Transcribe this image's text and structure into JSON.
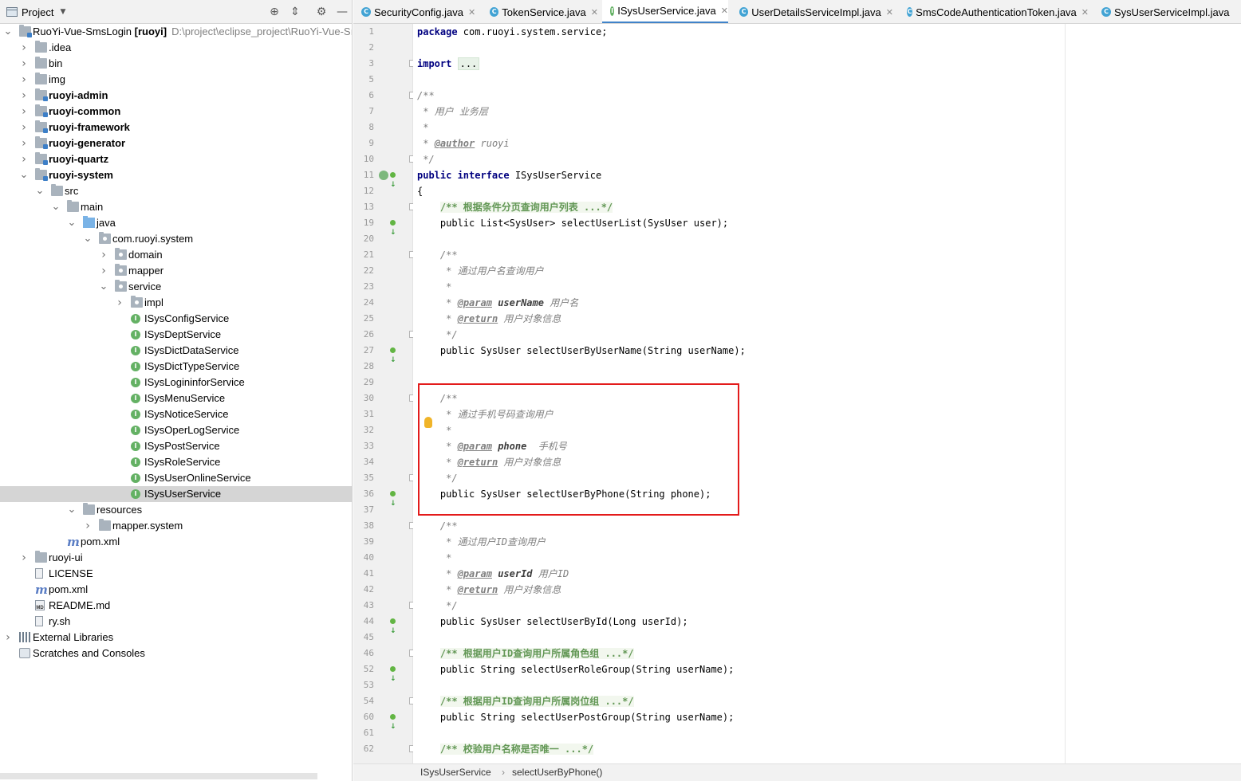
{
  "project": {
    "title": "Project",
    "tree": [
      {
        "label": "RuoYi-Vue-SmsLogin",
        "suffix": "[ruoyi]",
        "path": "D:\\project\\eclipse_project\\RuoYi-Vue-Sı",
        "icon": "module-folder-icon",
        "expanded": true,
        "bold": false
      },
      {
        "label": ".idea",
        "icon": "folder-icon",
        "expanded": false
      },
      {
        "label": "bin",
        "icon": "folder-icon",
        "expanded": false
      },
      {
        "label": "img",
        "icon": "folder-icon",
        "expanded": false
      },
      {
        "label": "ruoyi-admin",
        "icon": "module-folder-icon",
        "expanded": false,
        "bold": true
      },
      {
        "label": "ruoyi-common",
        "icon": "module-folder-icon",
        "expanded": false,
        "bold": true
      },
      {
        "label": "ruoyi-framework",
        "icon": "module-folder-icon",
        "expanded": false,
        "bold": true
      },
      {
        "label": "ruoyi-generator",
        "icon": "module-folder-icon",
        "expanded": false,
        "bold": true
      },
      {
        "label": "ruoyi-quartz",
        "icon": "module-folder-icon",
        "expanded": false,
        "bold": true
      },
      {
        "label": "ruoyi-system",
        "icon": "module-folder-icon",
        "expanded": true,
        "bold": true
      },
      {
        "label": "src",
        "icon": "folder-icon",
        "expanded": true
      },
      {
        "label": "main",
        "icon": "folder-icon",
        "expanded": true
      },
      {
        "label": "java",
        "icon": "source-folder-icon",
        "expanded": true
      },
      {
        "label": "com.ruoyi.system",
        "icon": "package-icon",
        "expanded": true
      },
      {
        "label": "domain",
        "icon": "package-icon",
        "expanded": false
      },
      {
        "label": "mapper",
        "icon": "package-icon",
        "expanded": false
      },
      {
        "label": "service",
        "icon": "package-icon",
        "expanded": true
      },
      {
        "label": "impl",
        "icon": "package-icon",
        "expanded": false
      },
      {
        "label": "ISysConfigService",
        "icon": "interface-icon"
      },
      {
        "label": "ISysDeptService",
        "icon": "interface-icon"
      },
      {
        "label": "ISysDictDataService",
        "icon": "interface-icon"
      },
      {
        "label": "ISysDictTypeService",
        "icon": "interface-icon"
      },
      {
        "label": "ISysLogininforService",
        "icon": "interface-icon"
      },
      {
        "label": "ISysMenuService",
        "icon": "interface-icon"
      },
      {
        "label": "ISysNoticeService",
        "icon": "interface-icon"
      },
      {
        "label": "ISysOperLogService",
        "icon": "interface-icon"
      },
      {
        "label": "ISysPostService",
        "icon": "interface-icon"
      },
      {
        "label": "ISysRoleService",
        "icon": "interface-icon"
      },
      {
        "label": "ISysUserOnlineService",
        "icon": "interface-icon"
      },
      {
        "label": "ISysUserService",
        "icon": "interface-icon",
        "selected": true
      },
      {
        "label": "resources",
        "icon": "resources-folder-icon",
        "expanded": true
      },
      {
        "label": "mapper.system",
        "icon": "folder-icon",
        "expanded": false
      },
      {
        "label": "pom.xml",
        "icon": "maven-icon"
      },
      {
        "label": "ruoyi-ui",
        "icon": "folder-icon",
        "expanded": false
      },
      {
        "label": "LICENSE",
        "icon": "text-file-icon"
      },
      {
        "label": "pom.xml",
        "icon": "maven-icon"
      },
      {
        "label": "README.md",
        "icon": "markdown-file-icon"
      },
      {
        "label": "ry.sh",
        "icon": "shell-file-icon"
      },
      {
        "label": "External Libraries",
        "icon": "libraries-icon",
        "expanded": false
      },
      {
        "label": "Scratches and Consoles",
        "icon": "scratches-icon"
      }
    ]
  },
  "tabs": [
    {
      "label": "SecurityConfig.java",
      "kind": "class",
      "closable": true
    },
    {
      "label": "TokenService.java",
      "kind": "class",
      "closable": true
    },
    {
      "label": "ISysUserService.java",
      "kind": "interface",
      "closable": true,
      "active": true
    },
    {
      "label": "UserDetailsServiceImpl.java",
      "kind": "class",
      "closable": true
    },
    {
      "label": "SmsCodeAuthenticationToken.java",
      "kind": "class",
      "closable": true
    },
    {
      "label": "SysUserServiceImpl.java",
      "kind": "class",
      "closable": false
    }
  ],
  "code": {
    "lines": [
      {
        "num": "1",
        "parts": [
          [
            "kw",
            "package"
          ],
          [
            "t",
            " com.ruoyi.system.service;"
          ]
        ]
      },
      {
        "num": "2",
        "parts": []
      },
      {
        "num": "3",
        "parts": [
          [
            "kw",
            "import"
          ],
          [
            "t",
            " "
          ],
          [
            "folded",
            "..."
          ]
        ]
      },
      {
        "num": "5",
        "parts": []
      },
      {
        "num": "6",
        "parts": [
          [
            "cm",
            "/**"
          ]
        ]
      },
      {
        "num": "7",
        "parts": [
          [
            "cm",
            " * 用户 业务层"
          ]
        ]
      },
      {
        "num": "8",
        "parts": [
          [
            "cm",
            " *"
          ]
        ]
      },
      {
        "num": "9",
        "parts": [
          [
            "cm",
            " * "
          ],
          [
            "tag",
            "@author"
          ],
          [
            "cm",
            " ruoyi"
          ]
        ]
      },
      {
        "num": "10",
        "parts": [
          [
            "cm",
            " */"
          ]
        ]
      },
      {
        "num": "11",
        "parts": [
          [
            "kw",
            "public interface"
          ],
          [
            "t",
            " ISysUserService"
          ]
        ]
      },
      {
        "num": "12",
        "parts": [
          [
            "t",
            "{"
          ]
        ]
      },
      {
        "num": "13",
        "parts": [
          [
            "t",
            "    "
          ],
          [
            "docf",
            "/** 根据条件分页查询用户列表 ...*/"
          ]
        ]
      },
      {
        "num": "19",
        "parts": [
          [
            "t",
            "    public List<SysUser> selectUserList(SysUser user);"
          ]
        ]
      },
      {
        "num": "20",
        "parts": []
      },
      {
        "num": "21",
        "parts": [
          [
            "t",
            "    "
          ],
          [
            "cm",
            "/**"
          ]
        ]
      },
      {
        "num": "22",
        "parts": [
          [
            "t",
            "    "
          ],
          [
            "cm",
            " * 通过用户名查询用户"
          ]
        ]
      },
      {
        "num": "23",
        "parts": [
          [
            "t",
            "    "
          ],
          [
            "cm",
            " *"
          ]
        ]
      },
      {
        "num": "24",
        "parts": [
          [
            "t",
            "    "
          ],
          [
            "cm",
            " * "
          ],
          [
            "tag",
            "@param"
          ],
          [
            "cm",
            " "
          ],
          [
            "tp",
            "userName"
          ],
          [
            "cm",
            " 用户名"
          ]
        ]
      },
      {
        "num": "25",
        "parts": [
          [
            "t",
            "    "
          ],
          [
            "cm",
            " * "
          ],
          [
            "tag",
            "@return"
          ],
          [
            "cm",
            " 用户对象信息"
          ]
        ]
      },
      {
        "num": "26",
        "parts": [
          [
            "t",
            "    "
          ],
          [
            "cm",
            " */"
          ]
        ]
      },
      {
        "num": "27",
        "parts": [
          [
            "t",
            "    public SysUser selectUserByUserName(String userName);"
          ]
        ]
      },
      {
        "num": "28",
        "parts": []
      },
      {
        "num": "29",
        "parts": []
      },
      {
        "num": "30",
        "parts": [
          [
            "t",
            "    "
          ],
          [
            "cm",
            "/**"
          ]
        ]
      },
      {
        "num": "31",
        "parts": [
          [
            "t",
            "    "
          ],
          [
            "cm",
            " * 通过手机号码查询用户"
          ]
        ]
      },
      {
        "num": "32",
        "parts": [
          [
            "t",
            "    "
          ],
          [
            "cm",
            " *"
          ]
        ]
      },
      {
        "num": "33",
        "parts": [
          [
            "t",
            "    "
          ],
          [
            "cm",
            " * "
          ],
          [
            "tag",
            "@param"
          ],
          [
            "cm",
            " "
          ],
          [
            "tp",
            "phone"
          ],
          [
            "cm",
            "  手机号"
          ]
        ]
      },
      {
        "num": "34",
        "parts": [
          [
            "t",
            "    "
          ],
          [
            "cm",
            " * "
          ],
          [
            "tag",
            "@return"
          ],
          [
            "cm",
            " 用户对象信息"
          ]
        ]
      },
      {
        "num": "35",
        "parts": [
          [
            "t",
            "    "
          ],
          [
            "cm",
            " */"
          ]
        ]
      },
      {
        "num": "36",
        "parts": [
          [
            "t",
            "    public SysUser selectUserByPhone(String phone);"
          ]
        ]
      },
      {
        "num": "37",
        "parts": []
      },
      {
        "num": "38",
        "parts": [
          [
            "t",
            "    "
          ],
          [
            "cm",
            "/**"
          ]
        ]
      },
      {
        "num": "39",
        "parts": [
          [
            "t",
            "    "
          ],
          [
            "cm",
            " * 通过用户ID查询用户"
          ]
        ]
      },
      {
        "num": "40",
        "parts": [
          [
            "t",
            "    "
          ],
          [
            "cm",
            " *"
          ]
        ]
      },
      {
        "num": "41",
        "parts": [
          [
            "t",
            "    "
          ],
          [
            "cm",
            " * "
          ],
          [
            "tag",
            "@param"
          ],
          [
            "cm",
            " "
          ],
          [
            "tp",
            "userId"
          ],
          [
            "cm",
            " 用户ID"
          ]
        ]
      },
      {
        "num": "42",
        "parts": [
          [
            "t",
            "    "
          ],
          [
            "cm",
            " * "
          ],
          [
            "tag",
            "@return"
          ],
          [
            "cm",
            " 用户对象信息"
          ]
        ]
      },
      {
        "num": "43",
        "parts": [
          [
            "t",
            "    "
          ],
          [
            "cm",
            " */"
          ]
        ]
      },
      {
        "num": "44",
        "parts": [
          [
            "t",
            "    public SysUser selectUserById(Long userId);"
          ]
        ]
      },
      {
        "num": "45",
        "parts": []
      },
      {
        "num": "46",
        "parts": [
          [
            "t",
            "    "
          ],
          [
            "docf",
            "/** 根据用户ID查询用户所属角色组 ...*/"
          ]
        ]
      },
      {
        "num": "52",
        "parts": [
          [
            "t",
            "    public String selectUserRoleGroup(String userName);"
          ]
        ]
      },
      {
        "num": "53",
        "parts": []
      },
      {
        "num": "54",
        "parts": [
          [
            "t",
            "    "
          ],
          [
            "docf",
            "/** 根据用户ID查询用户所属岗位组 ...*/"
          ]
        ]
      },
      {
        "num": "60",
        "parts": [
          [
            "t",
            "    public String selectUserPostGroup(String userName);"
          ]
        ]
      },
      {
        "num": "61",
        "parts": []
      },
      {
        "num": "62",
        "parts": [
          [
            "t",
            "    "
          ],
          [
            "docf",
            "/** 校验用户名称是否唯一 ...*/"
          ]
        ]
      }
    ]
  },
  "breadcrumb": {
    "items": [
      "ISysUserService",
      "selectUserByPhone()"
    ],
    "separator": "›"
  },
  "colors": {
    "highlight_box": "#e31b1b",
    "active_tab_underline": "#4083c9",
    "current_line": "#fdfbe3"
  }
}
